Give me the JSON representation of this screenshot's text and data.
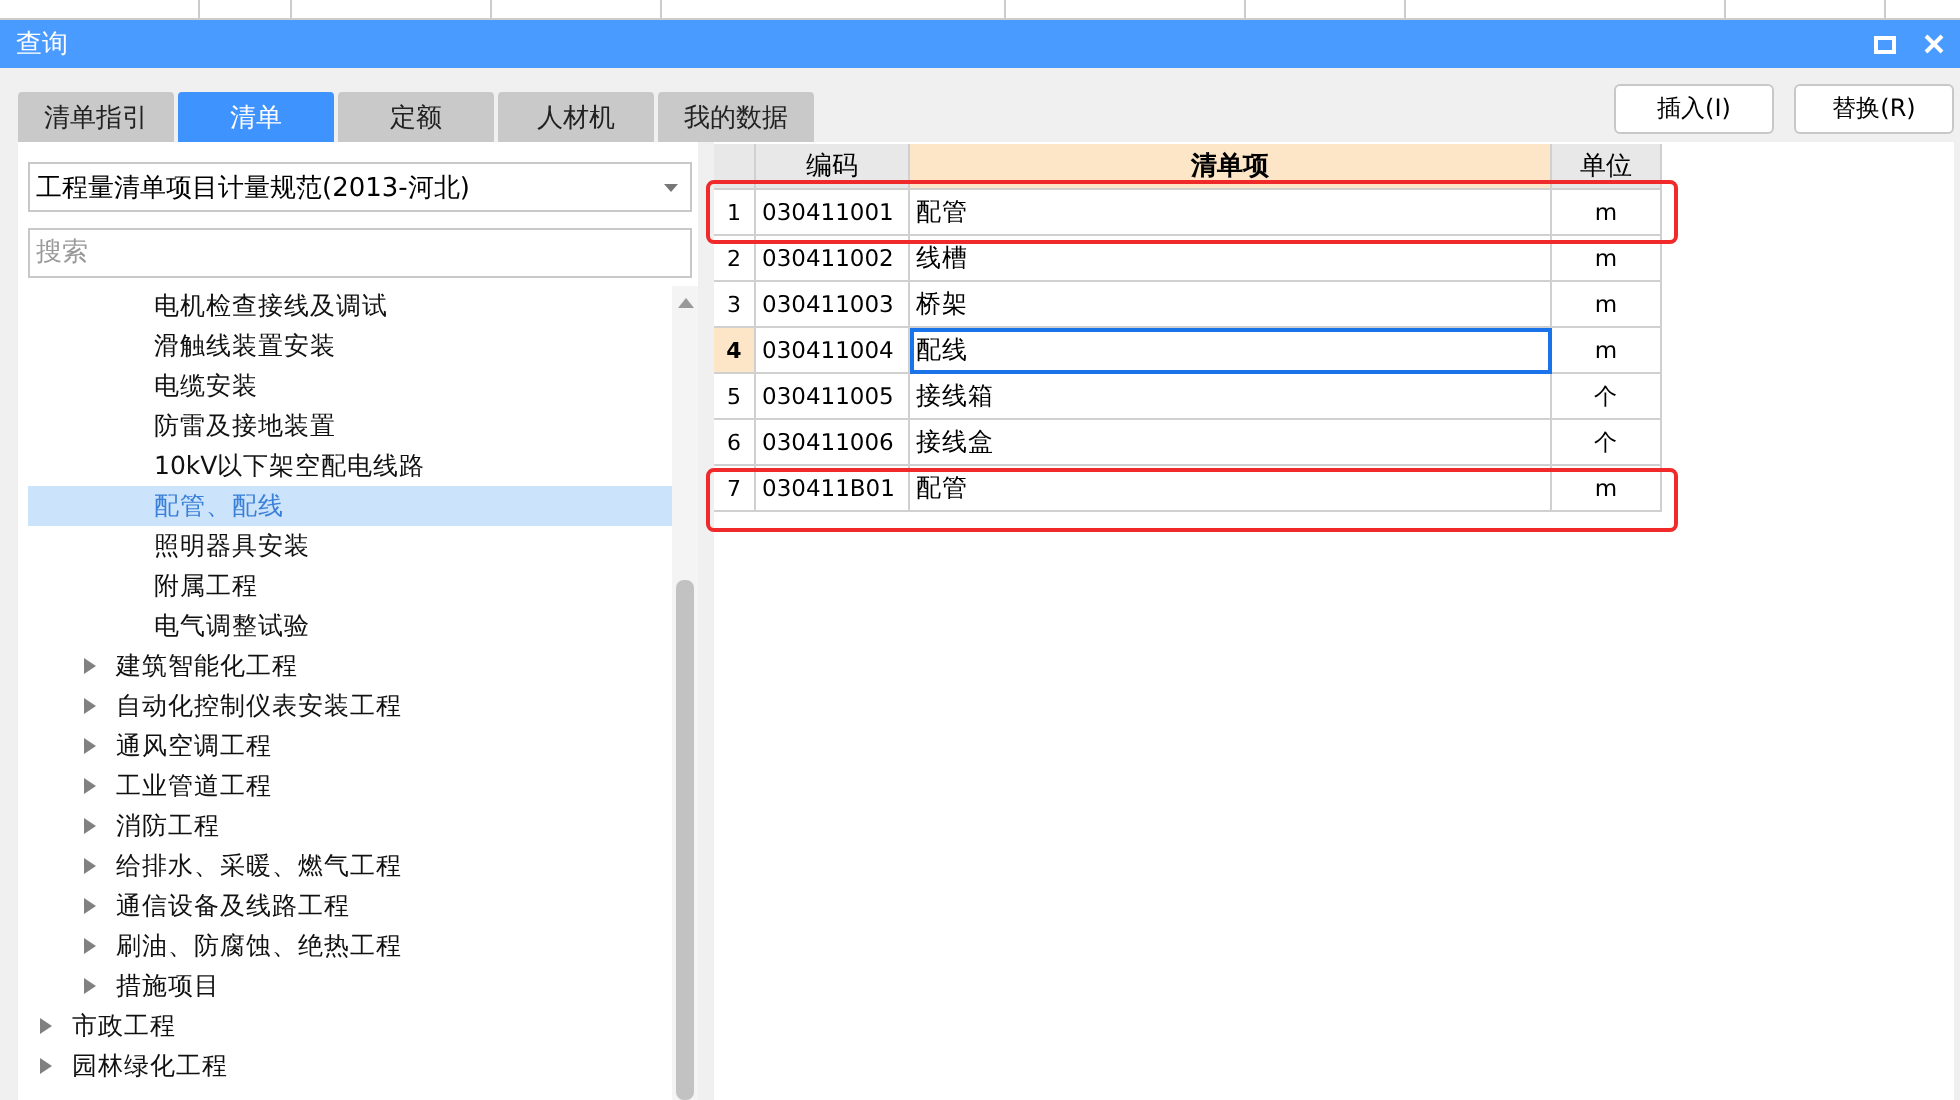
{
  "window": {
    "title": "查询"
  },
  "tabs": [
    {
      "label": "清单指引",
      "selected": false
    },
    {
      "label": "清单",
      "selected": true
    },
    {
      "label": "定额",
      "selected": false
    },
    {
      "label": "人材机",
      "selected": false
    },
    {
      "label": "我的数据",
      "selected": false
    }
  ],
  "buttons": [
    {
      "label": "插入(I)"
    },
    {
      "label": "替换(R)"
    }
  ],
  "standard_select": {
    "value": "工程量清单项目计量规范(2013-河北)"
  },
  "search": {
    "placeholder": "搜索"
  },
  "tree": {
    "items": [
      {
        "children": [
          {
            "children": [
              {
                "label": "电机检查接线及调试",
                "selected": false
              },
              {
                "label": "滑触线装置安装",
                "selected": false
              },
              {
                "label": "电缆安装",
                "selected": false
              },
              {
                "label": "防雷及接地装置",
                "selected": false
              },
              {
                "label": "10kV以下架空配电线路",
                "selected": false
              },
              {
                "label": "配管、配线",
                "selected": true
              },
              {
                "label": "照明器具安装",
                "selected": false
              },
              {
                "label": "附属工程",
                "selected": false
              },
              {
                "label": "电气调整试验",
                "selected": false
              }
            ]
          },
          {
            "label": "建筑智能化工程",
            "selected": false,
            "expanded": false
          },
          {
            "label": "自动化控制仪表安装工程",
            "selected": false,
            "expanded": false
          },
          {
            "label": "通风空调工程",
            "selected": false,
            "expanded": false
          },
          {
            "label": "工业管道工程",
            "selected": false,
            "expanded": false
          },
          {
            "label": "消防工程",
            "selected": false,
            "expanded": false
          },
          {
            "label": "给排水、采暖、燃气工程",
            "selected": false,
            "expanded": false
          },
          {
            "label": "通信设备及线路工程",
            "selected": false,
            "expanded": false
          },
          {
            "label": "刷油、防腐蚀、绝热工程",
            "selected": false,
            "expanded": false
          },
          {
            "label": "措施项目",
            "selected": false,
            "expanded": false
          }
        ]
      },
      {
        "label": "市政工程",
        "selected": false,
        "expanded": false
      },
      {
        "label": "园林绿化工程",
        "selected": false,
        "expanded": false
      }
    ]
  },
  "table": {
    "columns": [
      "编码",
      "清单项",
      "单位"
    ],
    "rows": [
      {
        "index": "1",
        "code": "030411001",
        "name": "配管",
        "unit": "m",
        "selected": false,
        "highlighted": true
      },
      {
        "index": "2",
        "code": "030411002",
        "name": "线槽",
        "unit": "m",
        "selected": false,
        "highlighted": false
      },
      {
        "index": "3",
        "code": "030411003",
        "name": "桥架",
        "unit": "m",
        "selected": false,
        "highlighted": false
      },
      {
        "index": "4",
        "code": "030411004",
        "name": "配线",
        "unit": "m",
        "selected": true,
        "highlighted": false
      },
      {
        "index": "5",
        "code": "030411005",
        "name": "接线箱",
        "unit": "个",
        "selected": false,
        "highlighted": false
      },
      {
        "index": "6",
        "code": "030411006",
        "name": "接线盒",
        "unit": "个",
        "selected": false,
        "highlighted": false
      },
      {
        "index": "7",
        "code": "030411B01",
        "name": "配管",
        "unit": "m",
        "selected": false,
        "highlighted": true
      }
    ]
  }
}
